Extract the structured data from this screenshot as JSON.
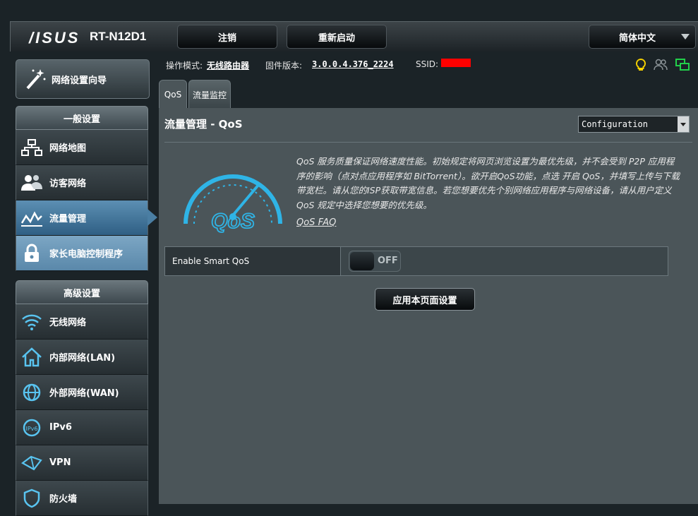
{
  "header": {
    "brand": "/ISUS",
    "model": "RT-N12D1",
    "logout_label": "注销",
    "reboot_label": "重新启动",
    "language": "简体中文"
  },
  "status": {
    "mode_label": "操作模式:",
    "mode_value": "无线路由器",
    "firmware_label": "固件版本:",
    "firmware_value": "3.0.0.4.376_2224",
    "ssid_label": "SSID:"
  },
  "sidebar": {
    "wizard_label": "网络设置向导",
    "general_title": "一般设置",
    "general_items": [
      {
        "label": "网络地图",
        "icon": "network-map-icon"
      },
      {
        "label": "访客网络",
        "icon": "guest-network-icon"
      },
      {
        "label": "流量管理",
        "icon": "traffic-manager-icon"
      },
      {
        "label": "家长电脑控制程序",
        "icon": "parental-control-icon"
      }
    ],
    "advanced_title": "高级设置",
    "advanced_items": [
      {
        "label": "无线网络",
        "icon": "wireless-icon"
      },
      {
        "label": "内部网络(LAN)",
        "icon": "lan-home-icon"
      },
      {
        "label": "外部网络(WAN)",
        "icon": "wan-globe-icon"
      },
      {
        "label": "IPv6",
        "icon": "ipv6-icon"
      },
      {
        "label": "VPN",
        "icon": "vpn-icon"
      },
      {
        "label": "防火墙",
        "icon": "firewall-icon"
      }
    ]
  },
  "tabs": [
    "QoS",
    "流量监控"
  ],
  "main": {
    "title": "流量管理 - QoS",
    "view_select": "Configuration",
    "description": "QoS 服务质量保证网络速度性能。初始规定将网页浏览设置为最优先级，并不会受到 P2P 应用程序的影响（点对点应用程序如 BitTorrent）。欲开启QoS功能，点选 开启 QoS，并填写上传与下载带宽栏。请从您的ISP获取带宽信息。若您想要优先个别网络应用程序与网络设备，请从用户定义 QoS 规定中选择您想要的优先级。",
    "faq_label": "QoS FAQ",
    "gauge_text": "QoS",
    "smart_qos_label": "Enable Smart QoS",
    "smart_qos_state": "OFF",
    "apply_label": "应用本页面设置"
  },
  "colors": {
    "accent": "#4a7ea3",
    "ssid_mask": "#ff0000",
    "gauge": "#2fb4e6"
  }
}
